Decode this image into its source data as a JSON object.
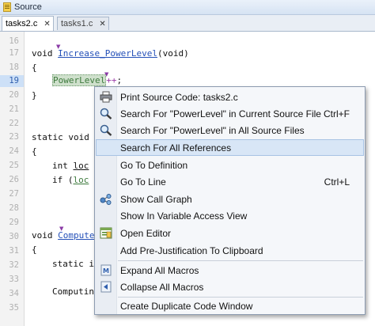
{
  "window": {
    "title": "Source"
  },
  "tabs": [
    {
      "label": "tasks2.c",
      "close": "✕",
      "active": true
    },
    {
      "label": "tasks1.c",
      "close": "✕",
      "active": false
    }
  ],
  "gutter": {
    "lines": [
      "16",
      "17",
      "18",
      "19",
      "20",
      "21",
      "22",
      "23",
      "24",
      "25",
      "26",
      "27",
      "28",
      "29",
      "30",
      "31",
      "32",
      "33",
      "34",
      "35"
    ],
    "current_line": "19"
  },
  "code": {
    "l17_kw": "void ",
    "l17_fn": "Increase_PowerLevel",
    "l17_tail": "(void)",
    "l18": "{",
    "l19_var": "PowerLevel",
    "l19_op": "++",
    "l19_tail": ";",
    "l20": "}",
    "l23": "static void C",
    "l24": "{",
    "l25_a": "int ",
    "l25_var": "loc",
    "l26_a": "if (",
    "l26_var": "loc",
    "l30_kw": "void ",
    "l30_fn": "Compute",
    "l31": "{",
    "l32": "static i",
    "l34": "Computin"
  },
  "context_menu": {
    "items": [
      {
        "label": "Print Source Code: tasks2.c",
        "shortcut": "",
        "icon": "printer-icon"
      },
      {
        "label": "Search For \"PowerLevel\" in Current Source File",
        "shortcut": "Ctrl+F",
        "icon": "magnifier-icon"
      },
      {
        "label": "Search For \"PowerLevel\" in All Source Files",
        "shortcut": "",
        "icon": "magnifier-icon"
      },
      {
        "label": "Search For All References",
        "shortcut": "",
        "icon": ""
      },
      {
        "label": "Go To Definition",
        "shortcut": "",
        "icon": ""
      },
      {
        "label": "Go To Line",
        "shortcut": "Ctrl+L",
        "icon": ""
      },
      {
        "label": "Show Call Graph",
        "shortcut": "",
        "icon": "call-graph-icon"
      },
      {
        "label": "Show In Variable Access View",
        "shortcut": "",
        "icon": ""
      },
      {
        "label": "Open Editor",
        "shortcut": "",
        "icon": "editor-icon"
      },
      {
        "label": "Add Pre-Justification To Clipboard",
        "shortcut": "",
        "icon": ""
      },
      {
        "label": "Expand All Macros",
        "shortcut": "",
        "icon": "expand-macros-icon"
      },
      {
        "label": "Collapse All Macros",
        "shortcut": "",
        "icon": "collapse-macros-icon"
      },
      {
        "label": "Create Duplicate Code Window",
        "shortcut": "",
        "icon": ""
      }
    ],
    "highlighted_index": 3
  },
  "colors": {
    "highlight": "#d8e6f6",
    "function_link": "#2450b8",
    "variable": "#3d7a3d",
    "operator": "#9a3aa5"
  }
}
